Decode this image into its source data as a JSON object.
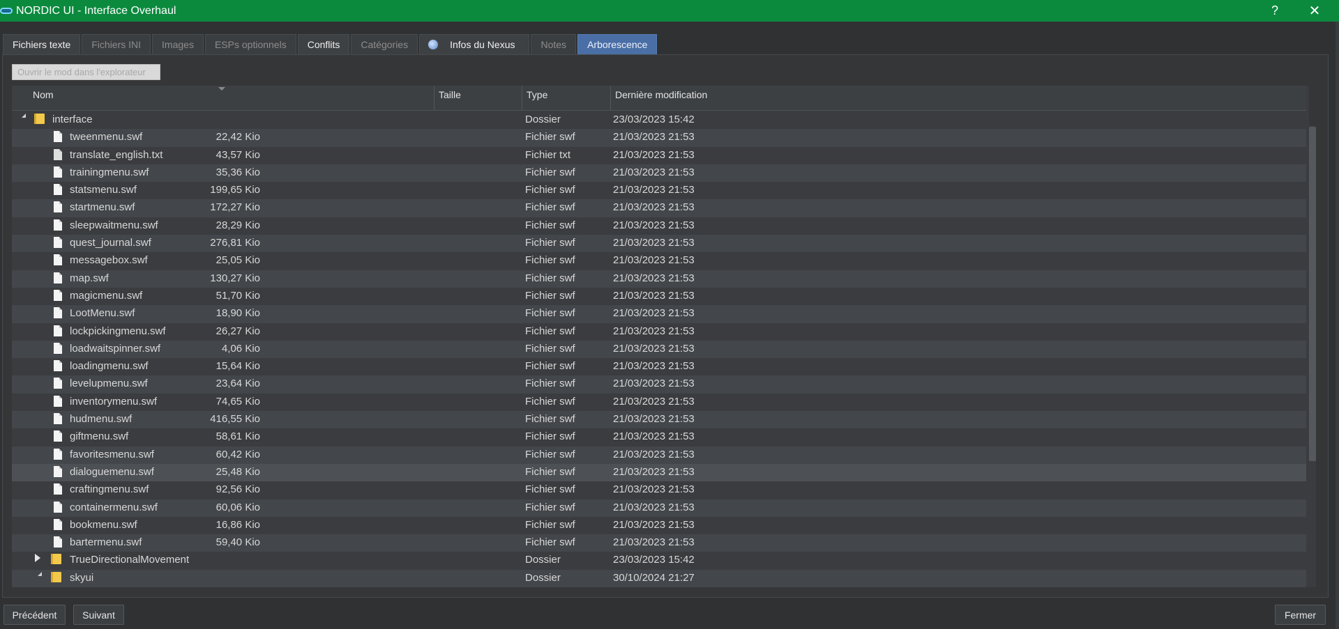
{
  "window": {
    "title": "NORDIC UI - Interface Overhaul",
    "help": "?",
    "close": "✕"
  },
  "tabs": [
    {
      "label": "Fichiers texte"
    },
    {
      "label": "Fichiers INI"
    },
    {
      "label": "Images"
    },
    {
      "label": "ESPs optionnels"
    },
    {
      "label": "Conflits"
    },
    {
      "label": "Catégories"
    },
    {
      "label": "Infos du Nexus"
    },
    {
      "label": "Notes"
    },
    {
      "label": "Arborescence"
    }
  ],
  "open_button": "Ouvrir le mod dans l'explorateur",
  "columns": {
    "name": "Nom",
    "size": "Taille",
    "type": "Type",
    "modified": "Dernière modification"
  },
  "rows": [
    {
      "name": "interface",
      "size": "",
      "type": "Dossier",
      "date": "23/03/2023 15:42"
    },
    {
      "name": "tweenmenu.swf",
      "size": "22,42 Kio",
      "type": "Fichier swf",
      "date": "21/03/2023 21:53"
    },
    {
      "name": "translate_english.txt",
      "size": "43,57 Kio",
      "type": "Fichier txt",
      "date": "21/03/2023 21:53"
    },
    {
      "name": "trainingmenu.swf",
      "size": "35,36 Kio",
      "type": "Fichier swf",
      "date": "21/03/2023 21:53"
    },
    {
      "name": "statsmenu.swf",
      "size": "199,65 Kio",
      "type": "Fichier swf",
      "date": "21/03/2023 21:53"
    },
    {
      "name": "startmenu.swf",
      "size": "172,27 Kio",
      "type": "Fichier swf",
      "date": "21/03/2023 21:53"
    },
    {
      "name": "sleepwaitmenu.swf",
      "size": "28,29 Kio",
      "type": "Fichier swf",
      "date": "21/03/2023 21:53"
    },
    {
      "name": "quest_journal.swf",
      "size": "276,81 Kio",
      "type": "Fichier swf",
      "date": "21/03/2023 21:53"
    },
    {
      "name": "messagebox.swf",
      "size": "25,05 Kio",
      "type": "Fichier swf",
      "date": "21/03/2023 21:53"
    },
    {
      "name": "map.swf",
      "size": "130,27 Kio",
      "type": "Fichier swf",
      "date": "21/03/2023 21:53"
    },
    {
      "name": "magicmenu.swf",
      "size": "51,70 Kio",
      "type": "Fichier swf",
      "date": "21/03/2023 21:53"
    },
    {
      "name": "LootMenu.swf",
      "size": "18,90 Kio",
      "type": "Fichier swf",
      "date": "21/03/2023 21:53"
    },
    {
      "name": "lockpickingmenu.swf",
      "size": "26,27 Kio",
      "type": "Fichier swf",
      "date": "21/03/2023 21:53"
    },
    {
      "name": "loadwaitspinner.swf",
      "size": "4,06 Kio",
      "type": "Fichier swf",
      "date": "21/03/2023 21:53"
    },
    {
      "name": "loadingmenu.swf",
      "size": "15,64 Kio",
      "type": "Fichier swf",
      "date": "21/03/2023 21:53"
    },
    {
      "name": "levelupmenu.swf",
      "size": "23,64 Kio",
      "type": "Fichier swf",
      "date": "21/03/2023 21:53"
    },
    {
      "name": "inventorymenu.swf",
      "size": "74,65 Kio",
      "type": "Fichier swf",
      "date": "21/03/2023 21:53"
    },
    {
      "name": "hudmenu.swf",
      "size": "416,55 Kio",
      "type": "Fichier swf",
      "date": "21/03/2023 21:53"
    },
    {
      "name": "giftmenu.swf",
      "size": "58,61 Kio",
      "type": "Fichier swf",
      "date": "21/03/2023 21:53"
    },
    {
      "name": "favoritesmenu.swf",
      "size": "60,42 Kio",
      "type": "Fichier swf",
      "date": "21/03/2023 21:53"
    },
    {
      "name": "dialoguemenu.swf",
      "size": "25,48 Kio",
      "type": "Fichier swf",
      "date": "21/03/2023 21:53"
    },
    {
      "name": "craftingmenu.swf",
      "size": "92,56 Kio",
      "type": "Fichier swf",
      "date": "21/03/2023 21:53"
    },
    {
      "name": "containermenu.swf",
      "size": "60,06 Kio",
      "type": "Fichier swf",
      "date": "21/03/2023 21:53"
    },
    {
      "name": "bookmenu.swf",
      "size": "16,86 Kio",
      "type": "Fichier swf",
      "date": "21/03/2023 21:53"
    },
    {
      "name": "bartermenu.swf",
      "size": "59,40 Kio",
      "type": "Fichier swf",
      "date": "21/03/2023 21:53"
    },
    {
      "name": "TrueDirectionalMovement",
      "size": "",
      "type": "Dossier",
      "date": "23/03/2023 15:42"
    },
    {
      "name": "skyui",
      "size": "",
      "type": "Dossier",
      "date": "30/10/2024 21:27"
    }
  ],
  "buttons": {
    "previous": "Précédent",
    "next": "Suivant",
    "close": "Fermer"
  }
}
